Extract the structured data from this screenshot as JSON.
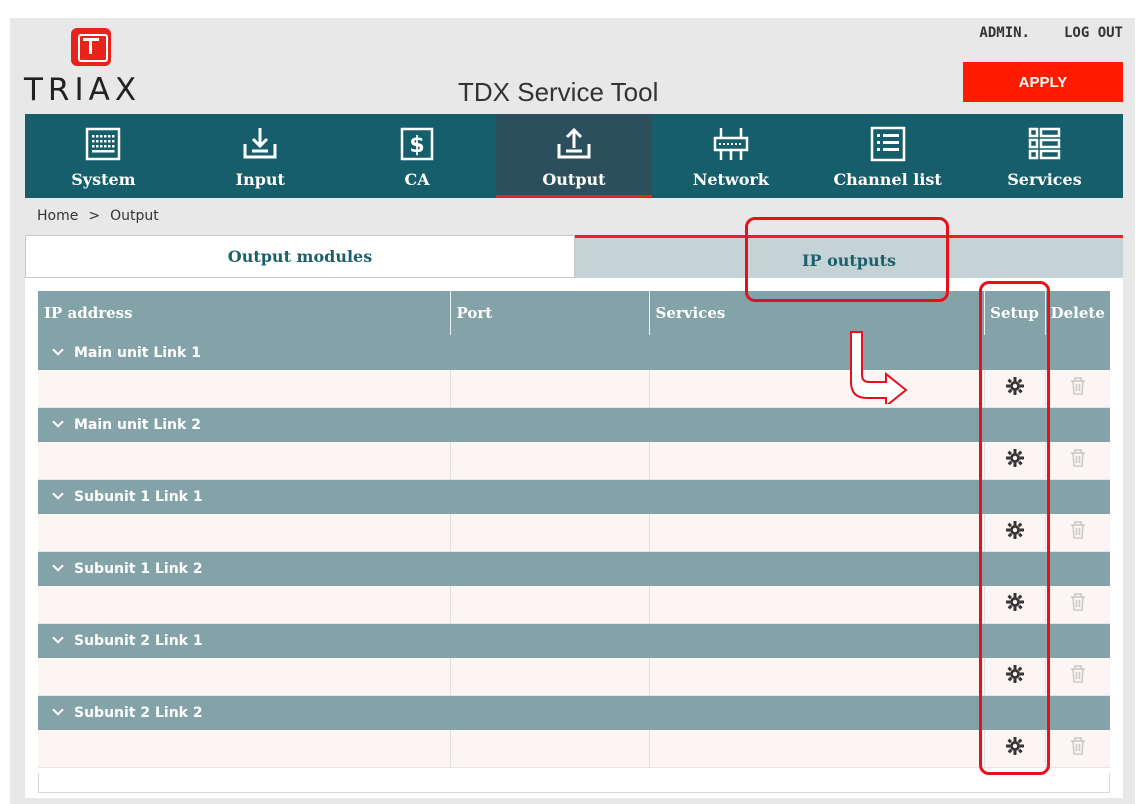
{
  "header": {
    "logo_text": "TRIAX",
    "title": "TDX Service Tool",
    "admin_label": "ADMIN.",
    "logout_label": "LOG OUT",
    "apply_label": "APPLY"
  },
  "nav": {
    "items": [
      {
        "label": "System",
        "icon": "keyboard-icon"
      },
      {
        "label": "Input",
        "icon": "download-tray-icon"
      },
      {
        "label": "CA",
        "icon": "dollar-doc-icon"
      },
      {
        "label": "Output",
        "icon": "upload-tray-icon",
        "active": true
      },
      {
        "label": "Network",
        "icon": "network-switch-icon"
      },
      {
        "label": "Channel list",
        "icon": "list-icon"
      },
      {
        "label": "Services",
        "icon": "services-icon"
      }
    ]
  },
  "breadcrumb": {
    "home": "Home",
    "separator": ">",
    "current": "Output"
  },
  "tabs": {
    "left": "Output modules",
    "right": "IP outputs"
  },
  "table": {
    "headers": {
      "ip_address": "IP address",
      "port": "Port",
      "services": "Services",
      "setup": "Setup",
      "delete": "Delete"
    },
    "groups": [
      {
        "label": "Main unit Link 1"
      },
      {
        "label": "Main unit Link 2"
      },
      {
        "label": "Subunit 1 Link 1"
      },
      {
        "label": "Subunit 1 Link 2"
      },
      {
        "label": "Subunit 2 Link 1"
      },
      {
        "label": "Subunit 2 Link 2"
      }
    ]
  },
  "colors": {
    "nav_bg": "#165e6b",
    "nav_active": "#2c4f5d",
    "accent_red": "#e8231c",
    "table_header": "#83a3a9",
    "row_bg": "#fdf5f4"
  }
}
